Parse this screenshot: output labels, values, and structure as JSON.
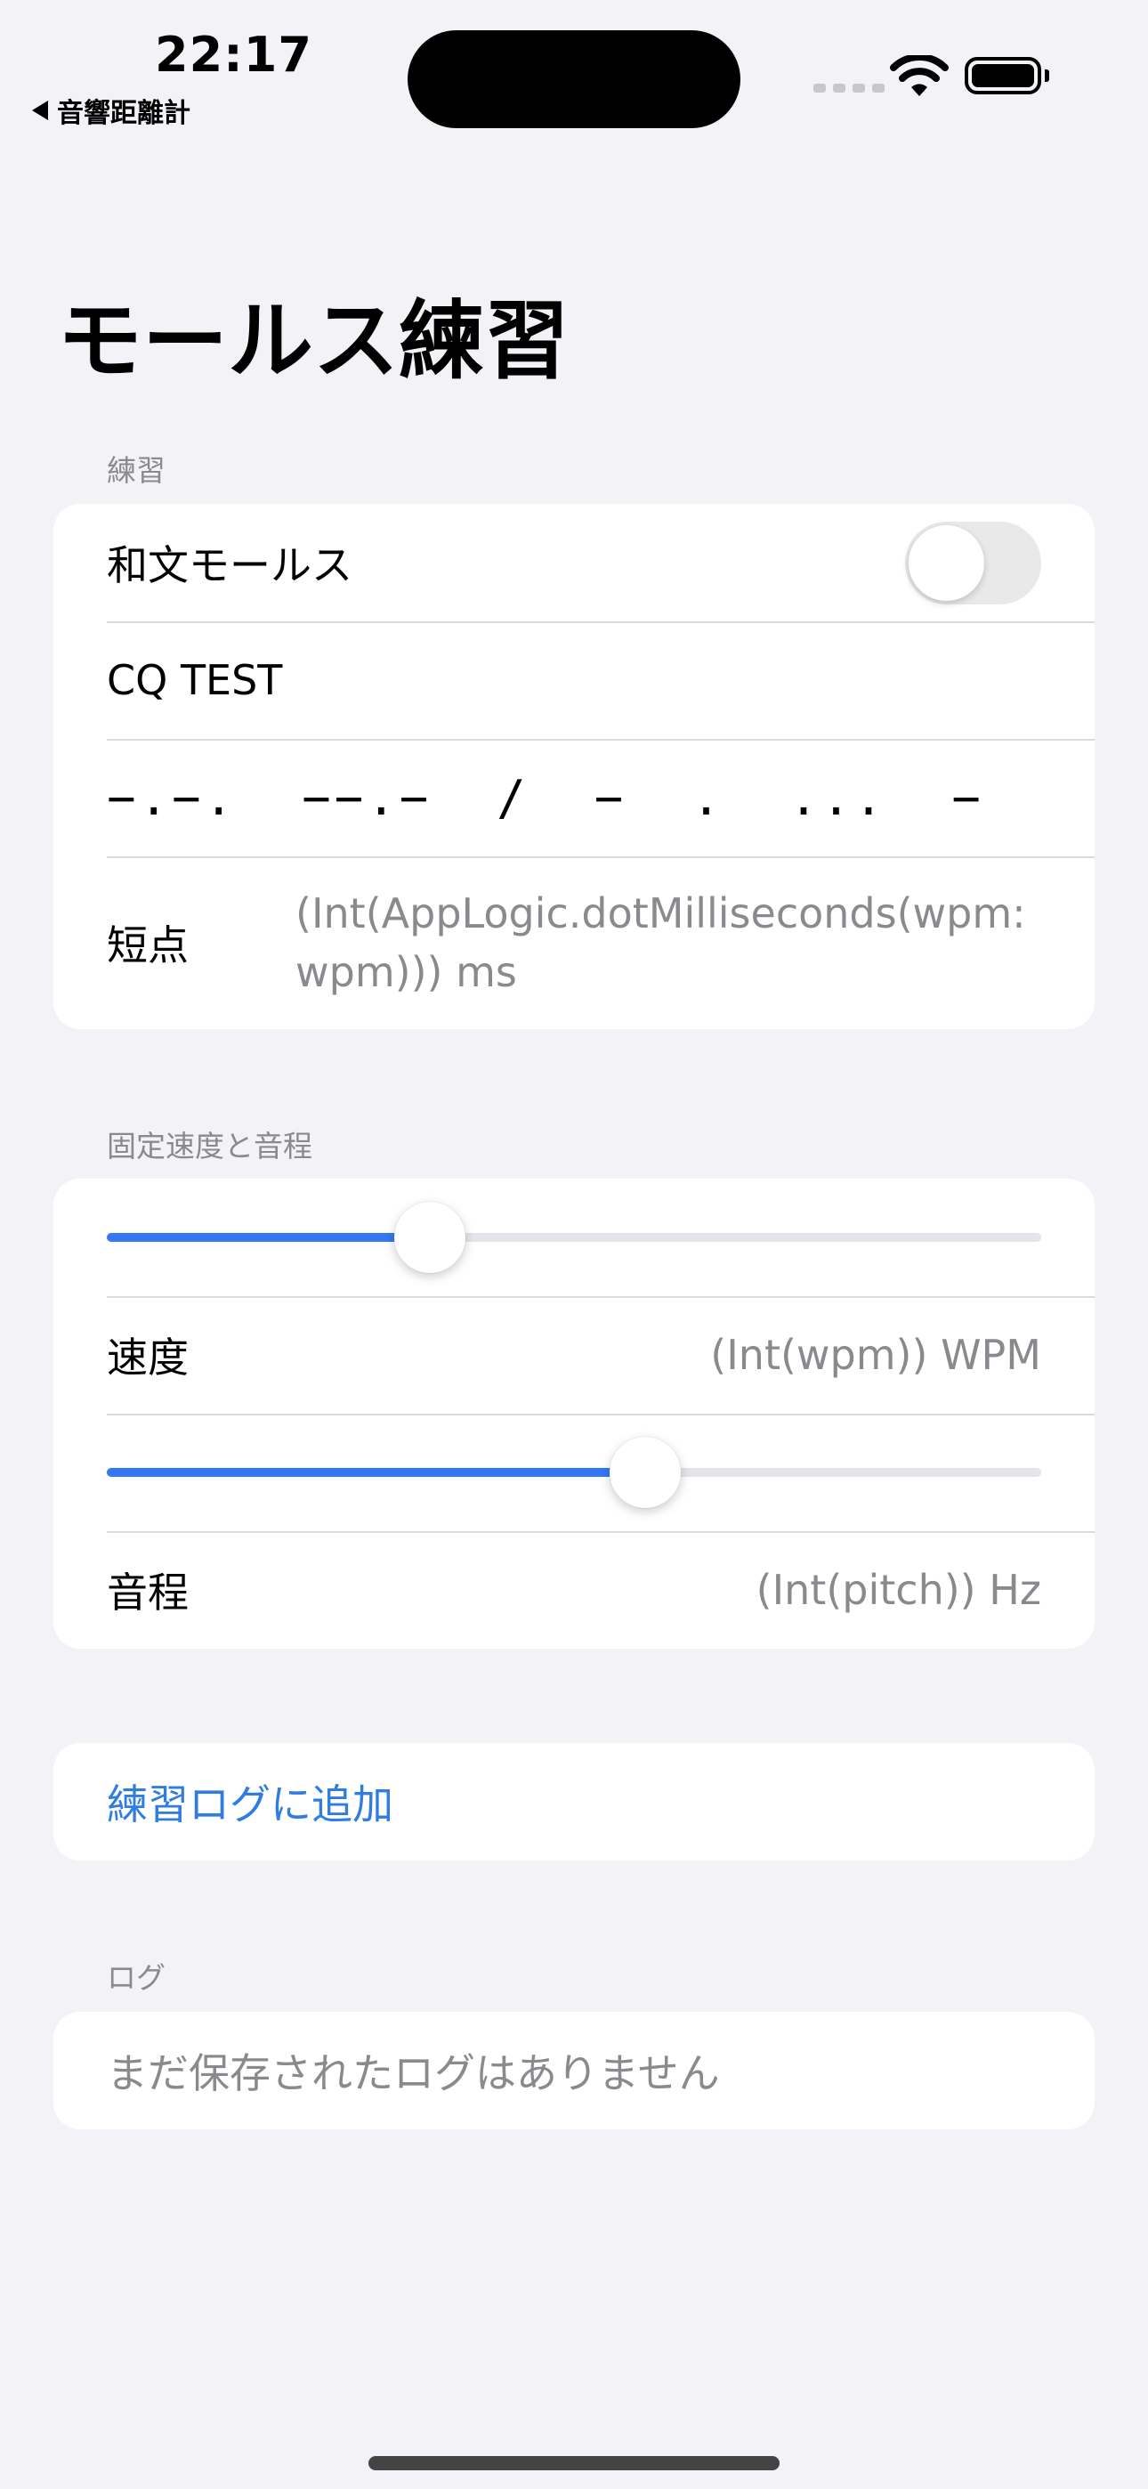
{
  "status_bar": {
    "time": "22:17",
    "back_label": "音響距離計"
  },
  "title": "モールス練習",
  "practice": {
    "header": "練習",
    "wabun_label": "和文モールス",
    "wabun_enabled": false,
    "text": "CQ TEST",
    "morse": "−.−.  −−.−  /  −  .  ...  −",
    "dot_label": "短点",
    "dot_value": "(Int(AppLogic.dotMilliseconds(wpm: wpm))) ms"
  },
  "speed_pitch": {
    "header": "固定速度と音程",
    "speed_slider_fraction": 0.346,
    "speed_label": "速度",
    "speed_value": "(Int(wpm)) WPM",
    "pitch_slider_fraction": 0.576,
    "pitch_label": "音程",
    "pitch_value": "(Int(pitch)) Hz"
  },
  "add_log_label": "練習ログに追加",
  "log": {
    "header": "ログ",
    "empty_text": "まだ保存されたログはありません"
  },
  "colors": {
    "accent": "#3478f6",
    "background": "#f2f2f7",
    "secondary_text": "#8a8a8e"
  }
}
